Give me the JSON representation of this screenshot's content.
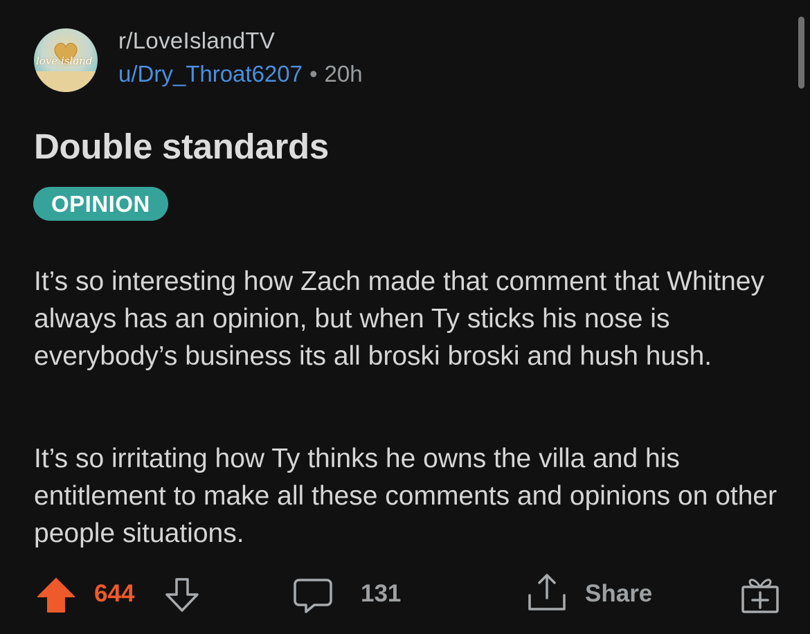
{
  "post": {
    "subreddit": "r/LoveIslandTV",
    "author": "u/Dry_Throat6207",
    "separator": "•",
    "age": "20h",
    "title": "Double standards",
    "flair": "OPINION",
    "body": [
      "It’s so interesting how Zach made that comment that Whitney always has an opinion, but when Ty sticks his nose is everybody’s business its all broski broski and hush hush.",
      "It’s so irritating how Ty thinks he owns the villa and his entitlement to make all these comments and opinions on other people situations."
    ],
    "avatar_text": "love island"
  },
  "actions": {
    "vote_count": "644",
    "comment_count": "131",
    "share_label": "Share"
  },
  "icons": {
    "upvote": "upvote-arrow-icon",
    "downvote": "downvote-arrow-icon",
    "comment": "comment-bubble-icon",
    "share": "share-upload-icon",
    "award": "gift-award-icon"
  },
  "colors": {
    "background": "#111111",
    "upvote_active": "#ee5a2a",
    "flair": "#36a39a",
    "username": "#4a8fe0"
  }
}
